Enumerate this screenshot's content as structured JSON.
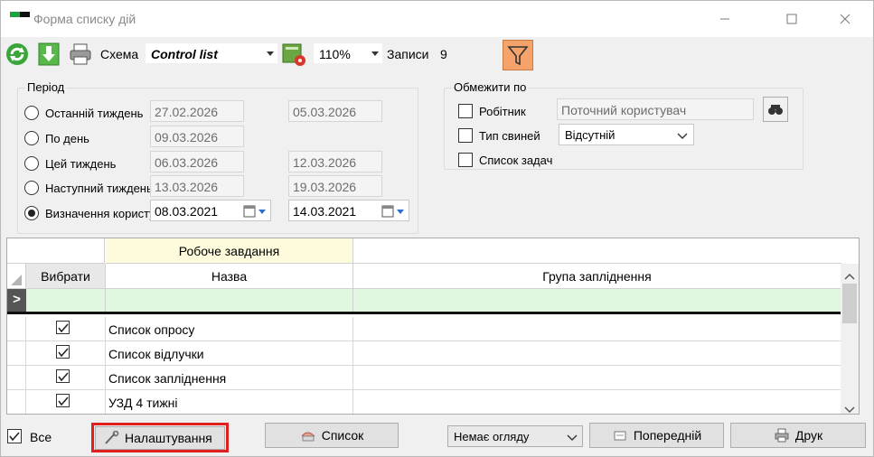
{
  "window": {
    "title": "Форма списку дій"
  },
  "toolbar": {
    "schema_label": "Схема",
    "schema_value": "Control list",
    "zoom_value": "110%",
    "records_label": "Записи",
    "records_value": "9"
  },
  "period": {
    "title": "Період",
    "options": [
      {
        "label": "Останній тиждень",
        "from": "27.02.2026",
        "to": "05.03.2026",
        "selected": false
      },
      {
        "label": "По день",
        "from": "09.03.2026",
        "to": "",
        "selected": false
      },
      {
        "label": "Цей тиждень",
        "from": "06.03.2026",
        "to": "12.03.2026",
        "selected": false
      },
      {
        "label": "Наступний тиждень",
        "from": "13.03.2026",
        "to": "19.03.2026",
        "selected": false
      },
      {
        "label": "Визначення користувача",
        "from": "08.03.2021",
        "to": "14.03.2021",
        "selected": true
      }
    ]
  },
  "restrict": {
    "title": "Обмежити по",
    "worker_label": "Робітник",
    "worker_value": "Поточний користувач",
    "pig_type_label": "Тип свиней",
    "pig_type_value": "Відсутній",
    "task_list_label": "Список задач"
  },
  "grid": {
    "group_header": "Робоче завдання",
    "columns": {
      "select": "Вибрати",
      "name": "Назва",
      "group": "Група запліднення"
    },
    "new_row_marker": ">",
    "rows": [
      {
        "checked": true,
        "name": "Список опросу",
        "group": ""
      },
      {
        "checked": true,
        "name": "Список відлучки",
        "group": ""
      },
      {
        "checked": true,
        "name": "Список запліднення",
        "group": ""
      },
      {
        "checked": true,
        "name": "УЗД 4 тижні",
        "group": ""
      }
    ]
  },
  "footer": {
    "all_label": "Все",
    "settings_button": "Налаштування",
    "list_button": "Список",
    "review_value": "Немає огляду",
    "previous_button": "Попередній",
    "print_button": "Друк"
  },
  "colors": {
    "highlight": "#e0201e",
    "filter_active": "#f6a26b",
    "new_row": "#dff8df",
    "group_header": "#fdfbdc"
  }
}
